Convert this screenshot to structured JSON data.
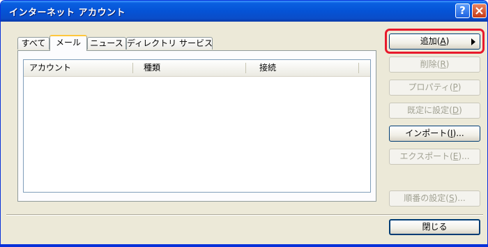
{
  "window": {
    "title": "インターネット アカウント",
    "help_glyph": "?",
    "colors": {
      "titlebar": "#0553d6",
      "face": "#ece9d8",
      "highlight": "#e8192c",
      "tab_active_accent": "#ffc73c"
    }
  },
  "tabs": [
    {
      "label": "すべて",
      "active": false
    },
    {
      "label": "メール",
      "active": true
    },
    {
      "label": "ニュース",
      "active": false
    },
    {
      "label": "ディレクトリ サービス",
      "active": false
    }
  ],
  "list": {
    "columns": [
      "アカウント",
      "種類",
      "接続"
    ],
    "rows": []
  },
  "buttons": {
    "add": {
      "label": "追加",
      "mnemonic": "A",
      "suffix": "",
      "enabled": true,
      "has_arrow": true
    },
    "remove": {
      "label": "削除",
      "mnemonic": "R",
      "suffix": "",
      "enabled": false
    },
    "properties": {
      "label": "プロパティ",
      "mnemonic": "P",
      "suffix": "",
      "enabled": false
    },
    "set_default": {
      "label": "既定に設定",
      "mnemonic": "D",
      "suffix": "",
      "enabled": false
    },
    "import": {
      "label": "インポート",
      "mnemonic": "I",
      "suffix": "...",
      "enabled": true
    },
    "export": {
      "label": "エクスポート",
      "mnemonic": "E",
      "suffix": "...",
      "enabled": false
    },
    "order": {
      "label": "順番の設定",
      "mnemonic": "S",
      "suffix": "...",
      "enabled": false
    },
    "close": {
      "label": "閉じる",
      "enabled": true
    }
  }
}
